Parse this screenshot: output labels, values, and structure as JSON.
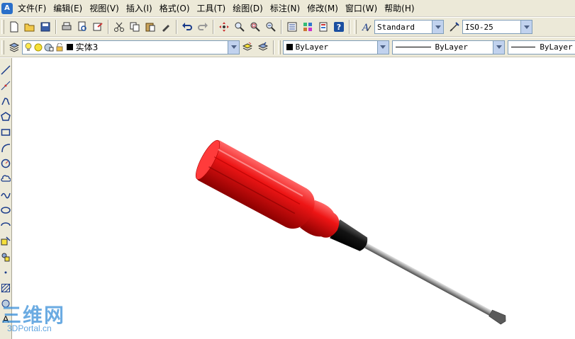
{
  "menu": {
    "app_icon_text": "A",
    "items": [
      "文件(F)",
      "编辑(E)",
      "视图(V)",
      "插入(I)",
      "格式(O)",
      "工具(T)",
      "绘图(D)",
      "标注(N)",
      "修改(M)",
      "窗口(W)",
      "帮助(H)"
    ]
  },
  "toolbar": {
    "text_style": "Standard",
    "dim_style": "ISO-25"
  },
  "layers": {
    "current_layer": "实体3",
    "color": "ByLayer",
    "linetype": "ByLayer",
    "lineweight": "ByLayer"
  },
  "drawbar": {
    "text_tool": "A"
  },
  "watermark": {
    "main": "三维网",
    "sub": "3DPortal.cn"
  },
  "colors": {
    "handle": "#e01010",
    "ferrule": "#111111",
    "shaft": "#a0a0a0",
    "background": "#ffffff",
    "toolbar": "#ece9d8"
  }
}
